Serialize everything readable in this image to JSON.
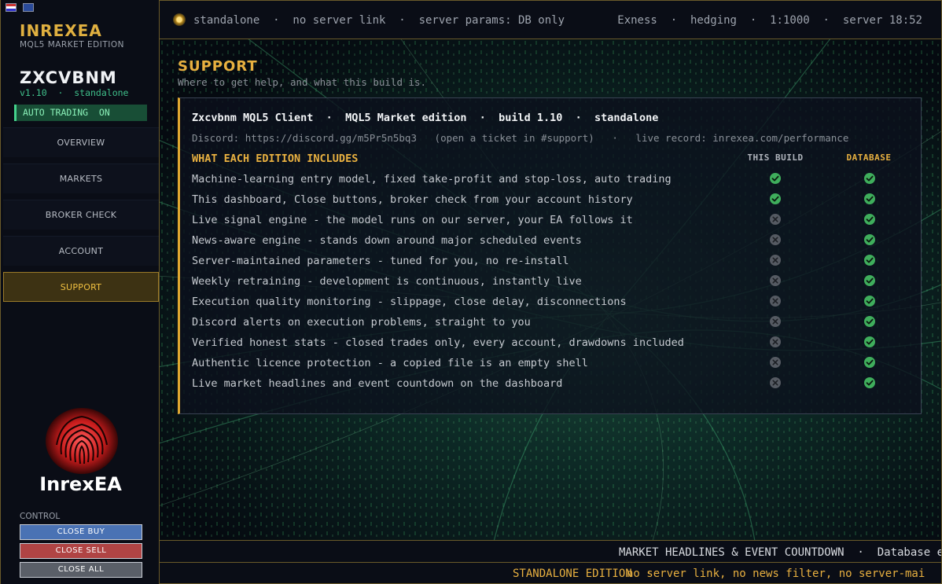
{
  "sidebar": {
    "brand": "INREXEA",
    "brand_sub": "MQL5 MARKET EDITION",
    "account_name": "ZXCVBNM",
    "version_line": "v1.10  ·  standalone",
    "auto_trading": "AUTO TRADING  ON",
    "nav": [
      {
        "label": "OVERVIEW",
        "active": false
      },
      {
        "label": "MARKETS",
        "active": false
      },
      {
        "label": "BROKER CHECK",
        "active": false
      },
      {
        "label": "ACCOUNT",
        "active": false
      },
      {
        "label": "SUPPORT",
        "active": true
      }
    ],
    "logo_text": "InrexEA",
    "control_label": "CONTROL",
    "buttons": {
      "close_buy": "CLOSE BUY",
      "close_sell": "CLOSE SELL",
      "close_all": "CLOSE ALL"
    }
  },
  "topbar": {
    "left": "standalone  ·  no server link  ·  server params: DB only",
    "right": "Exness  ·  hedging  ·  1:1000  ·  server 18:52"
  },
  "support": {
    "title": "SUPPORT",
    "subtitle": "Where to get help, and what this build is.",
    "header": "Zxcvbnm MQL5 Client  ·  MQL5 Market edition  ·  build 1.10  ·  standalone",
    "info": "Discord: https://discord.gg/m5Pr5n5bq3   (open a ticket in #support)   ·   live record: inrexea.com/performance",
    "section": "WHAT EACH EDITION INCLUDES",
    "col_this": "THIS BUILD",
    "col_db": "DATABASE",
    "features": [
      {
        "text": "Machine-learning entry model, fixed take-profit and stop-loss, auto trading",
        "this_build": true,
        "database": true
      },
      {
        "text": "This dashboard, Close buttons, broker check from your account history",
        "this_build": true,
        "database": true
      },
      {
        "text": "Live signal engine - the model runs on our server, your EA follows it",
        "this_build": false,
        "database": true
      },
      {
        "text": "News-aware engine - stands down around major scheduled events",
        "this_build": false,
        "database": true
      },
      {
        "text": "Server-maintained parameters - tuned for you, no re-install",
        "this_build": false,
        "database": true
      },
      {
        "text": "Weekly retraining - development is continuous, instantly live",
        "this_build": false,
        "database": true
      },
      {
        "text": "Execution quality monitoring - slippage, close delay, disconnections",
        "this_build": false,
        "database": true
      },
      {
        "text": "Discord alerts on execution problems, straight to you",
        "this_build": false,
        "database": true
      },
      {
        "text": "Verified honest stats - closed trades only, every account, drawdowns included",
        "this_build": false,
        "database": true
      },
      {
        "text": "Authentic licence protection - a copied file is an empty shell",
        "this_build": false,
        "database": true
      },
      {
        "text": "Live market headlines and event countdown on the dashboard",
        "this_build": false,
        "database": true
      }
    ]
  },
  "ticker1": "MARKET HEADLINES & EVENT COUNTDOWN  ·  Database edi",
  "ticker2": {
    "label": "STANDALONE EDITION  ·",
    "text": "no server link, no news filter, no server-mai"
  },
  "colors": {
    "accent": "#e8b040",
    "active_green": "#3fae5c",
    "inactive": "#555a62"
  }
}
